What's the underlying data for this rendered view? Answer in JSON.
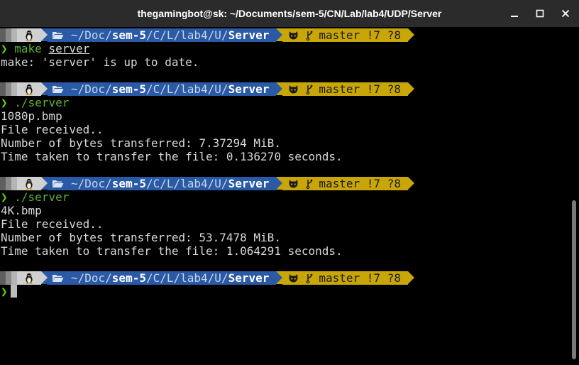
{
  "window": {
    "title": "thegamingbot@sk: ~/Documents/sem-5/CN/Lab/lab4/UDP/Server",
    "controls": {
      "minimize_icon": "minimize-icon",
      "maximize_icon": "maximize-icon",
      "close_icon": "close-icon"
    }
  },
  "prompt": {
    "path_dim_prefix": "~/Doc/",
    "path_bold_1": "sem-5",
    "path_dim_middle": "/C/L/lab4/U/",
    "path_bold_2": "Server",
    "git_branch": "master",
    "git_status": "!7 ?8",
    "prompt_char": "❯",
    "colors": {
      "path_bg": "#2a5aa5",
      "git_bg": "#c9a608",
      "prompt_char": "#5fd700",
      "command": "#5fb02e"
    }
  },
  "session": [
    {
      "command": "make",
      "command_arg": "server",
      "output": [
        "make: 'server' is up to date."
      ]
    },
    {
      "command": "./server",
      "command_arg": "",
      "output": [
        "1080p.bmp",
        "File received..",
        "Number of bytes transferred: 7.37294 MiB.",
        "Time taken to transfer the file: 0.136270 seconds."
      ]
    },
    {
      "command": "./server",
      "command_arg": "",
      "output": [
        "4K.bmp",
        "File received..",
        "Number of bytes transferred: 53.7478 MiB.",
        "Time taken to transfer the file: 1.064291 seconds."
      ]
    }
  ]
}
